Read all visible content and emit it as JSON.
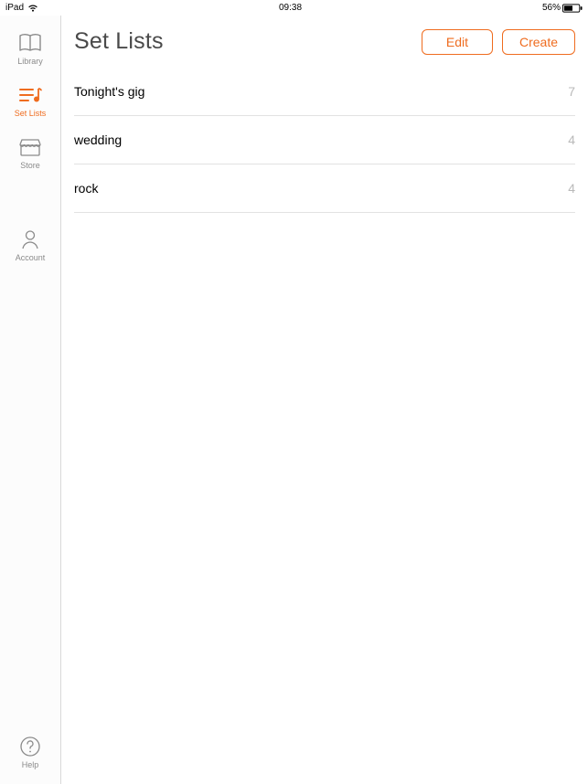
{
  "status": {
    "device": "iPad",
    "time": "09:38",
    "battery": "56%"
  },
  "sidebar": {
    "items": [
      {
        "label": "Library"
      },
      {
        "label": "Set Lists"
      },
      {
        "label": "Store"
      },
      {
        "label": "Account"
      },
      {
        "label": "Help"
      }
    ]
  },
  "header": {
    "title": "Set Lists",
    "edit": "Edit",
    "create": "Create"
  },
  "lists": [
    {
      "name": "Tonight's gig",
      "count": "7"
    },
    {
      "name": "wedding",
      "count": "4"
    },
    {
      "name": "rock",
      "count": "4"
    }
  ],
  "colors": {
    "accent": "#ef6c1f"
  }
}
